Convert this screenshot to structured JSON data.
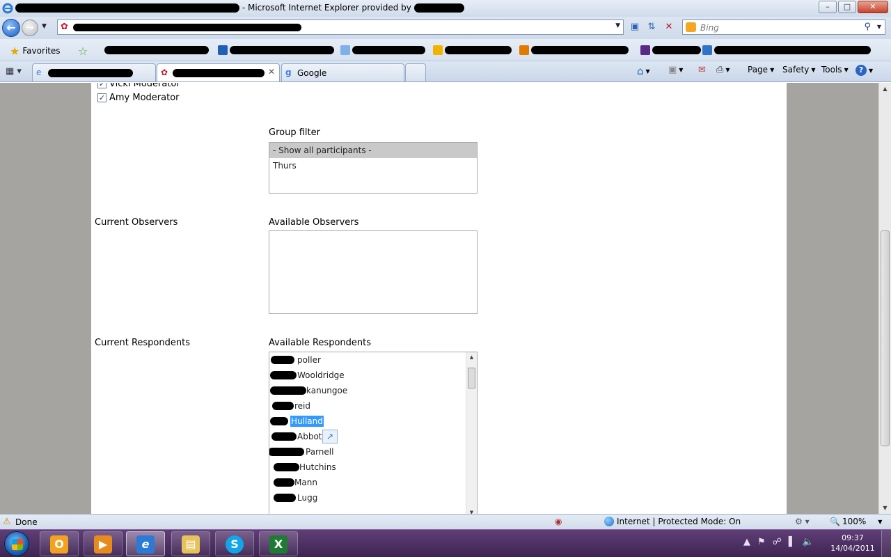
{
  "window": {
    "title_suffix": "- Microsoft Internet Explorer provided by",
    "controls": {
      "minimize": "–",
      "maximize": "□",
      "close": "✕"
    }
  },
  "address_bar": {
    "search_placeholder": "Bing"
  },
  "favorites_bar": {
    "favorites_label": "Favorites"
  },
  "tabs": [
    {
      "label": ""
    },
    {
      "label": "",
      "active": true
    },
    {
      "label": "Google"
    }
  ],
  "command_bar": {
    "page": "Page",
    "safety": "Safety",
    "tools": "Tools",
    "help": "?"
  },
  "page": {
    "moderators": [
      {
        "name": "Vicki Moderator",
        "checked": true
      },
      {
        "name": "Amy Moderator",
        "checked": true
      }
    ],
    "group_filter": {
      "label": "Group filter",
      "options": [
        "- Show all participants -",
        "Thurs"
      ],
      "selected": "- Show all participants -"
    },
    "current_observers_label": "Current Observers",
    "available_observers_label": "Available Observers",
    "current_respondents_label": "Current Respondents",
    "available_respondents_label": "Available Respondents",
    "respondents": [
      {
        "name": "poller"
      },
      {
        "name": "Wooldridge"
      },
      {
        "name": "kanungoe"
      },
      {
        "name": "reid"
      },
      {
        "name": "Hulland",
        "selected": true
      },
      {
        "name": "Abbott"
      },
      {
        "name": "Parnell"
      },
      {
        "name": "Hutchins"
      },
      {
        "name": "Mann"
      },
      {
        "name": "Lugg"
      }
    ]
  },
  "status_bar": {
    "status": "Done",
    "security": "Internet | Protected Mode: On",
    "zoom": "100%"
  },
  "taskbar": {
    "apps": [
      "outlook",
      "media-player",
      "internet-explorer",
      "windows-explorer",
      "skype",
      "excel"
    ],
    "time": "09:37",
    "date": "14/04/2011"
  }
}
